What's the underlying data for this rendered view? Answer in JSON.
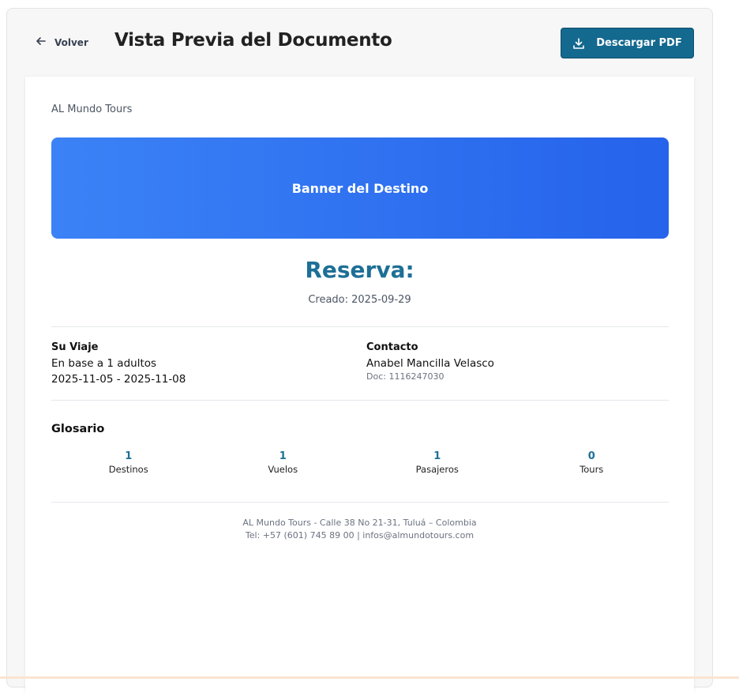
{
  "header": {
    "back_label": "Volver",
    "title": "Vista Previa del Documento",
    "download_label": "Descargar PDF"
  },
  "document": {
    "company": "AL Mundo Tours",
    "banner_text": "Banner del Destino",
    "reservation_title": "Reserva:",
    "created": "Creado: 2025-09-29",
    "trip": {
      "heading": "Su Viaje",
      "adults": "En base a 1 adultos",
      "dates": "2025-11-05 - 2025-11-08"
    },
    "contact": {
      "heading": "Contacto",
      "name": "Anabel Mancilla Velasco",
      "doc": "Doc: 1116247030"
    },
    "glossary": {
      "heading": "Glosario",
      "stats": [
        {
          "value": "1",
          "label": "Destinos"
        },
        {
          "value": "1",
          "label": "Vuelos"
        },
        {
          "value": "1",
          "label": "Pasajeros"
        },
        {
          "value": "0",
          "label": "Tours"
        }
      ]
    },
    "footer": {
      "line1": "AL Mundo Tours - Calle 38 No 21-31, Tuluá – Colombia",
      "line2": "Tel: +57 (601) 745 89 00 | infos@almundotours.com"
    }
  },
  "colors": {
    "accent": "#14698f",
    "title_blue": "#1d6f96",
    "banner_start": "#3b82f6",
    "banner_end": "#2563eb"
  },
  "icons": {
    "back": "arrow-left-icon",
    "download": "download-icon"
  }
}
